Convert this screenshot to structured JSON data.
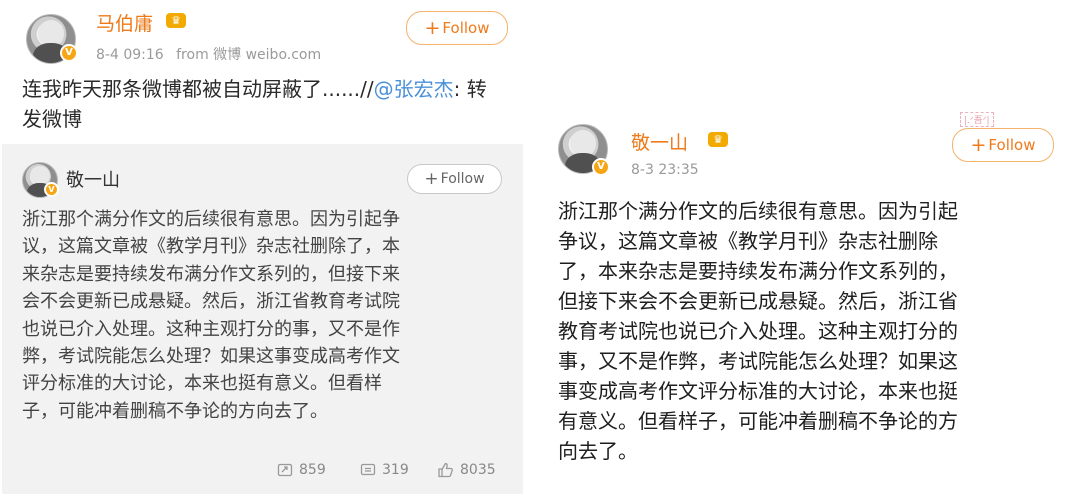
{
  "left_post": {
    "username": "马伯庸",
    "time": "8-4 09:16",
    "source": "from 微博 weibo.com",
    "follow_label": "Follow",
    "text_prefix": "连我昨天那条微博都被自动屏蔽了......//",
    "mention": "@张宏杰",
    "text_suffix": ": 转发微博",
    "repost": {
      "username": "敬一山",
      "follow_label": "Follow",
      "lines": [
        "浙江那个满分作文的后续很有意思。因为引起争",
        "议，这篇文章被《教学月刊》杂志社删除了，本",
        "来杂志是要持续发布满分作文系列的，但接下来",
        "会不会更新已成悬疑。然后，浙江省教育考试院",
        "也说已介入处理。这种主观打分的事，又不是作",
        "弊，考试院能怎么处理？如果这事变成高考作文",
        "评分标准的大讨论，本来也挺有意义。但看样",
        "子，可能冲着删稿不争论的方向去了。"
      ],
      "stats": {
        "reposts": "859",
        "comments": "319",
        "likes": "8035"
      }
    }
  },
  "right_post": {
    "username": "敬一山",
    "time": "8-3 23:35",
    "follow_label": "Follow",
    "lines": [
      "浙江那个满分作文的后续很有意思。因为引起",
      "争议，这篇文章被《教学月刊》杂志社删除",
      "了，本来杂志是要持续发布满分作文系列的，",
      "但接下来会不会更新已成悬疑。然后，浙江省",
      "教育考试院也说已介入处理。这种主观打分的",
      "事，又不是作弊，考试院能怎么处理？如果这",
      "事变成高考作文评分标准的大讨论，本来也挺",
      "有意义。但看样子，可能冲着删稿不争论的方",
      "向去了。"
    ]
  },
  "colors": {
    "username": "#ef7a1a",
    "mention": "#4a90d9",
    "follow": "#f07a1a",
    "repost_bg": "#f2f2f2"
  }
}
